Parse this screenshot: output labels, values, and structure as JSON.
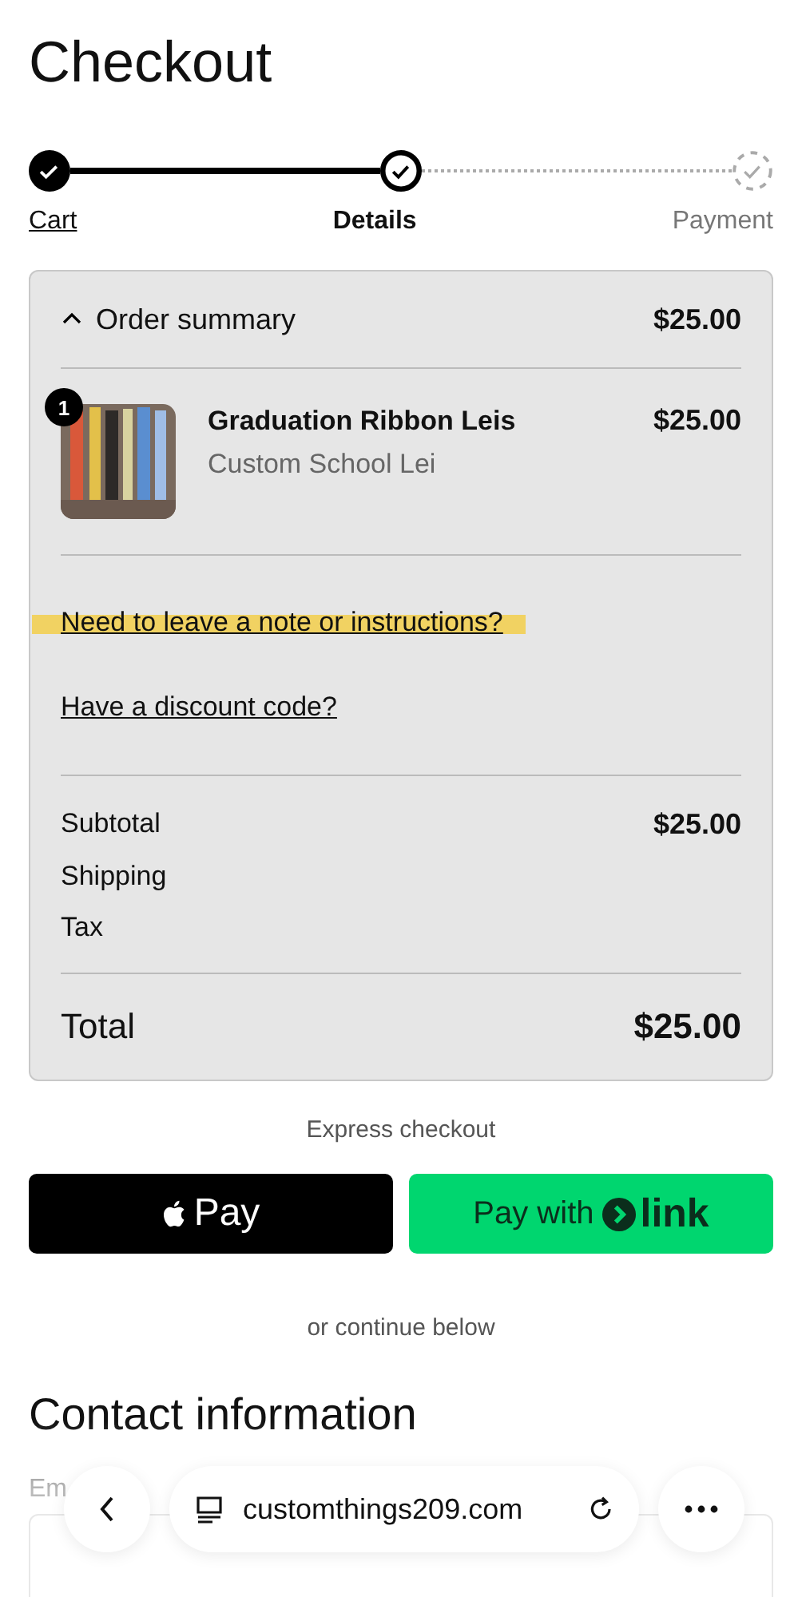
{
  "page": {
    "title": "Checkout"
  },
  "steps": [
    {
      "label": "Cart",
      "complete": true,
      "current": false
    },
    {
      "label": "Details",
      "complete": false,
      "current": true
    },
    {
      "label": "Payment",
      "complete": false,
      "current": false
    }
  ],
  "order_summary": {
    "toggle_label": "Order summary",
    "expanded": true,
    "total": "$25.00",
    "items": [
      {
        "quantity": "1",
        "name": "Graduation Ribbon Leis",
        "variant": "Custom School Lei",
        "price": "$25.00"
      }
    ],
    "links": [
      {
        "label": "Need to leave a note or instructions?",
        "highlighted": true
      },
      {
        "label": "Have a discount code?",
        "highlighted": false
      }
    ],
    "lines": [
      {
        "label": "Subtotal",
        "value": "$25.00"
      },
      {
        "label": "Shipping"
      },
      {
        "label": "Tax"
      }
    ],
    "grand_total": {
      "label": "Total",
      "value": "$25.00"
    }
  },
  "express_checkout": {
    "heading": "Express checkout",
    "buttons": [
      {
        "kind": "apple",
        "label": "Pay"
      },
      {
        "kind": "link",
        "label": "Pay with",
        "brand": "link"
      }
    ],
    "divider_text": "or continue below"
  },
  "contact": {
    "heading": "Contact information",
    "email_label": "Em"
  },
  "browser_bar": {
    "url": "customthings209.com"
  }
}
